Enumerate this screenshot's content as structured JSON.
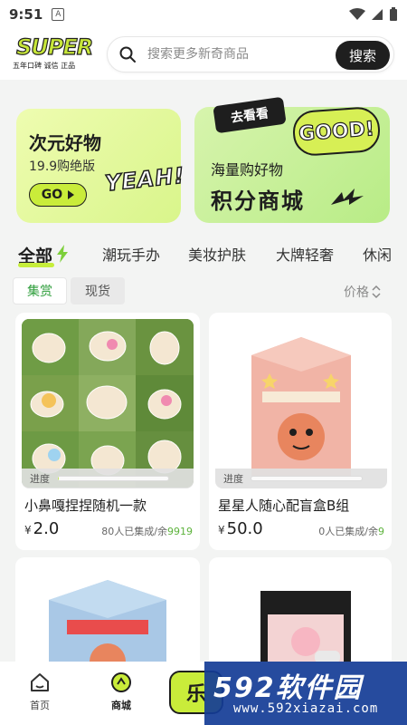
{
  "status_bar": {
    "time": "9:51",
    "notif_letter": "A"
  },
  "header": {
    "logo_text": "SUPER",
    "logo_tagline": "五年口碑 诚信 正品",
    "search_placeholder": "搜索更多新奇商品",
    "search_button": "搜索"
  },
  "banners": {
    "left": {
      "title": "次元好物",
      "subtitle": "19.9购绝版",
      "go_label": "GO",
      "sticker": "YEAH!"
    },
    "right": {
      "subtitle": "海量购好物",
      "title": "积分商城",
      "sticker_go_see": "去看看",
      "sticker_good": "GOOD!"
    }
  },
  "categories": [
    "全部",
    "潮玩手办",
    "美妆护肤",
    "大牌轻奢",
    "休闲"
  ],
  "sub_tabs": {
    "active": "集赏",
    "inactive": "现货"
  },
  "sort": {
    "label": "价格"
  },
  "products": [
    {
      "name": "小鼻嘎捏捏随机一款",
      "currency": "¥",
      "price": "2.0",
      "joined": "80人已集成/余",
      "remaining": "9919",
      "progress_label": "进度",
      "progress": 0.01
    },
    {
      "name": "星星人随心配盲盒B组",
      "currency": "¥",
      "price": "50.0",
      "joined": "0人已集成/余",
      "remaining": "9",
      "progress_label": "进度",
      "progress": 0.0
    },
    {
      "name": "",
      "currency": "",
      "price": "",
      "joined": "",
      "remaining": ""
    },
    {
      "name": "",
      "currency": "",
      "price": "",
      "joined": "",
      "remaining": ""
    }
  ],
  "bottom_nav": {
    "home": "首页",
    "mall": "商城",
    "center_label": "乐"
  },
  "watermark": {
    "main": "592软件园",
    "url": "www.592xiazai.com"
  },
  "colors": {
    "accent": "#c9ec3a",
    "green_text": "#2f9e3c",
    "dark": "#1e1e1e"
  }
}
